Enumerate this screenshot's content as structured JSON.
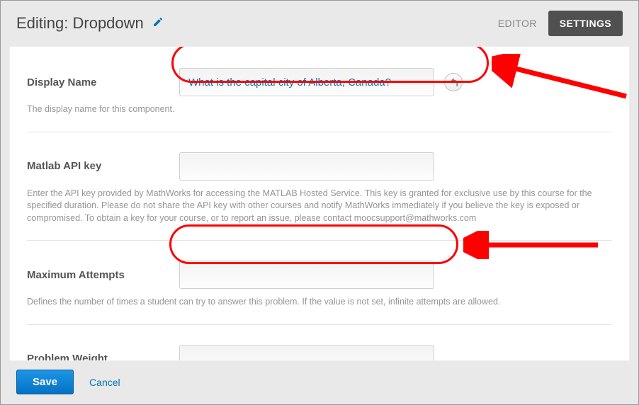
{
  "header": {
    "title": "Editing: Dropdown",
    "tab_editor": "EDITOR",
    "tab_settings": "SETTINGS"
  },
  "fields": {
    "display_name": {
      "label": "Display Name",
      "value": "What is the capital city of Alberta, Canada?",
      "help": "The display name for this component."
    },
    "matlab_api_key": {
      "label": "Matlab API key",
      "value": "",
      "help": "Enter the API key provided by MathWorks for accessing the MATLAB Hosted Service. This key is granted for exclusive use by this course for the specified duration. Please do not share the API key with other courses and notify MathWorks immediately if you believe the key is exposed or compromised. To obtain a key for your course, or to report an issue, please contact moocsupport@mathworks.com"
    },
    "maximum_attempts": {
      "label": "Maximum Attempts",
      "value": "",
      "help": "Defines the number of times a student can try to answer this problem. If the value is not set, infinite attempts are allowed."
    },
    "problem_weight": {
      "label": "Problem Weight",
      "value": ""
    }
  },
  "footer": {
    "save": "Save",
    "cancel": "Cancel"
  },
  "icons": {
    "edit": "pencil-icon",
    "reset": "undo-icon"
  }
}
